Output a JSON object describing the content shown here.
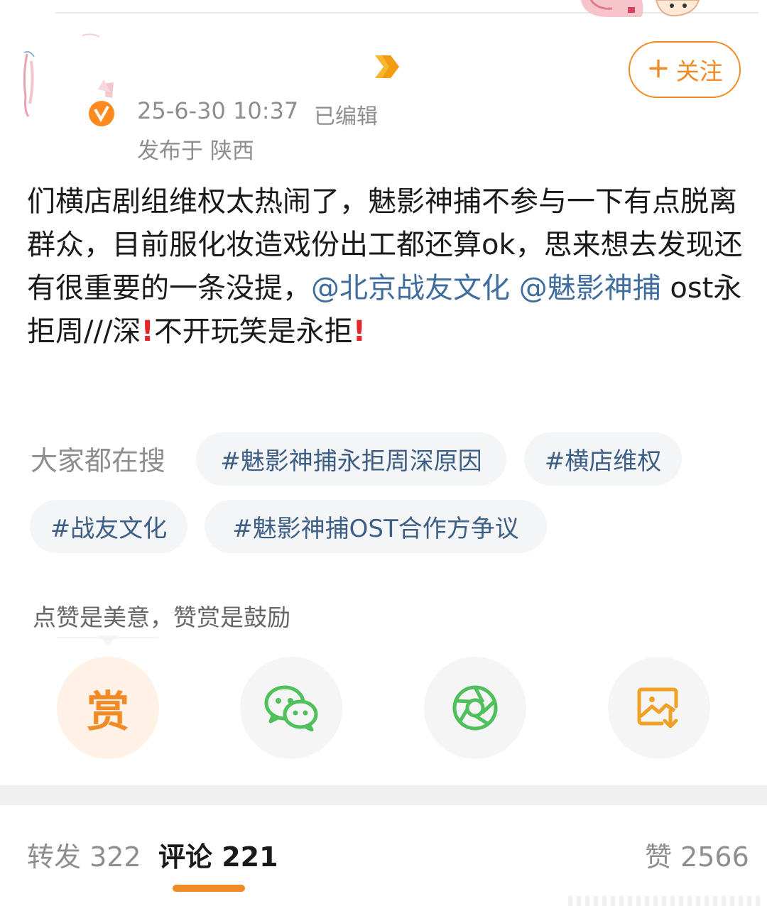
{
  "header": {
    "post_time": "25-6-30 10:37",
    "edited": "已编辑",
    "location": "发布于 陕西",
    "follow_plus": "+",
    "follow_label": "关注"
  },
  "post": {
    "seg1": "们横店剧组维权太热闹了，魅影神捕不参与一下有点脱离群众，目前服化妆造戏份出工都还算ok，思来想去发现还有很重要的一条没提，",
    "mention1": "@北京战友文化",
    "space": " ",
    "mention2": "@魅影神捕",
    "seg2": "  ost永拒周///深",
    "excl1": "!",
    "seg3": "不开玩笑是永拒",
    "excl2": "!"
  },
  "hot_search": {
    "label": "大家都在搜",
    "chips": [
      "#魅影神捕永拒周深原因",
      "#横店维权",
      "#战友文化",
      "#魅影神捕OST合作方争议"
    ]
  },
  "reward": {
    "hint": "点赞是美意，赞赏是鼓励",
    "reward_char": "赏"
  },
  "share_icons": [
    "reward-icon",
    "wechat-icon",
    "moments-icon",
    "save-image-icon"
  ],
  "stats": {
    "repost": "转发 322",
    "comments": "评论 221",
    "likes": "赞 2566"
  },
  "colors": {
    "accent": "#f08a24",
    "link": "#3f6d9e",
    "wechat_green": "#4fc05b",
    "alert_red": "#e5242b"
  }
}
